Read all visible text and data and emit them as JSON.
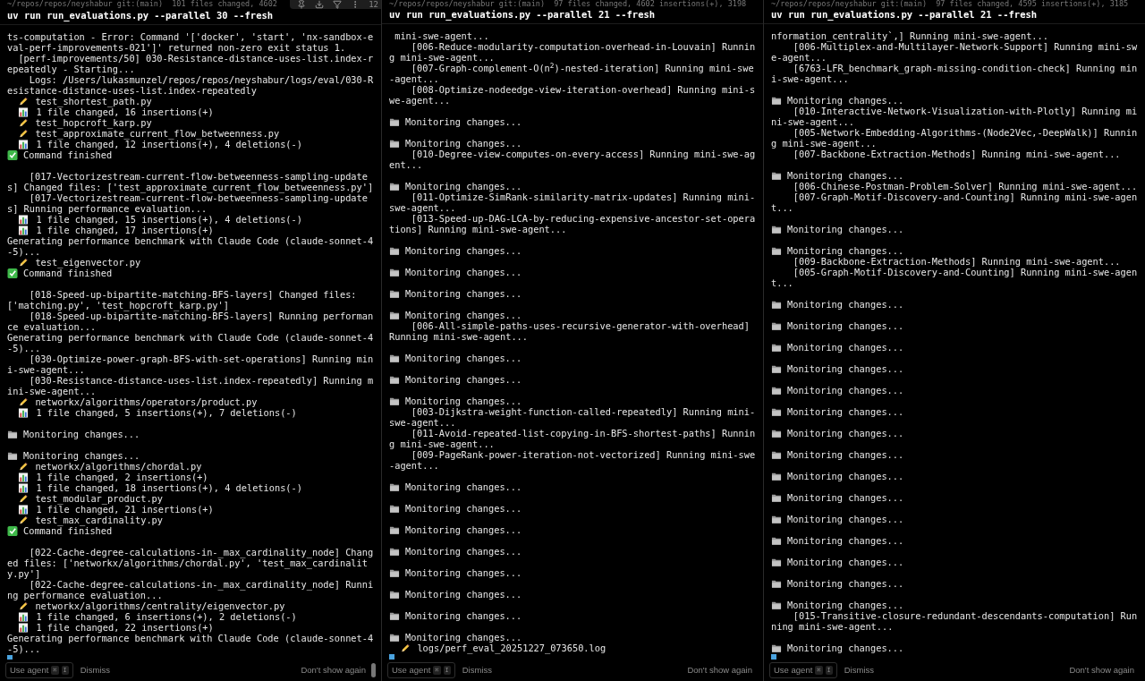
{
  "panes": [
    {
      "status": "~/repos/repos/neyshabur git:(main)  101 files changed, 4602",
      "command": "uv run run_evaluations.py --parallel 30 --fresh",
      "toolbar": {
        "count": "12"
      },
      "scrollbar": true,
      "lines": [
        {
          "kind": "text",
          "text": "ts-computation - Error: Command '['docker', 'start', 'nx-sandbox-eval-perf-improvements-021']' returned non-zero exit status 1."
        },
        {
          "kind": "sub",
          "text": "[perf-improvements/50] 030-Resistance-distance-uses-list.index-repeatedly - Starting..."
        },
        {
          "kind": "task",
          "text": "Logs: /Users/lukasmunzel/repos/repos/neyshabur/logs/eval/030-Resistance-distance-uses-list.index-repeatedly"
        },
        {
          "kind": "edit",
          "text": "test_shortest_path.py"
        },
        {
          "kind": "stats",
          "text": "1 file changed, 16 insertions(+)"
        },
        {
          "kind": "edit",
          "text": "test_hopcroft_karp.py"
        },
        {
          "kind": "edit",
          "text": "test_approximate_current_flow_betweenness.py"
        },
        {
          "kind": "stats",
          "text": "1 file changed, 12 insertions(+), 4 deletions(-)"
        },
        {
          "kind": "done",
          "text": "Command finished"
        },
        {
          "kind": "blank"
        },
        {
          "kind": "task",
          "text": "[017-Vectorizestream-current-flow-betweenness-sampling-updates] Changed files: ['test_approximate_current_flow_betweenness.py']"
        },
        {
          "kind": "task",
          "text": "[017-Vectorizestream-current-flow-betweenness-sampling-updates] Running performance evaluation..."
        },
        {
          "kind": "stats",
          "text": "1 file changed, 15 insertions(+), 4 deletions(-)"
        },
        {
          "kind": "stats",
          "text": "1 file changed, 17 insertions(+)"
        },
        {
          "kind": "text",
          "text": "Generating performance benchmark with Claude Code (claude-sonnet-4-5)..."
        },
        {
          "kind": "edit",
          "text": "test_eigenvector.py"
        },
        {
          "kind": "done",
          "text": "Command finished"
        },
        {
          "kind": "blank"
        },
        {
          "kind": "task",
          "text": "[018-Speed-up-bipartite-matching-BFS-layers] Changed files: ['matching.py', 'test_hopcroft_karp.py']"
        },
        {
          "kind": "task",
          "text": "[018-Speed-up-bipartite-matching-BFS-layers] Running performance evaluation..."
        },
        {
          "kind": "text",
          "text": "Generating performance benchmark with Claude Code (claude-sonnet-4-5)..."
        },
        {
          "kind": "task",
          "text": "[030-Optimize-power-graph-BFS-with-set-operations] Running mini-swe-agent..."
        },
        {
          "kind": "task",
          "text": "[030-Resistance-distance-uses-list.index-repeatedly] Running mini-swe-agent..."
        },
        {
          "kind": "edit",
          "text": "networkx/algorithms/operators/product.py"
        },
        {
          "kind": "stats",
          "text": "1 file changed, 5 insertions(+), 7 deletions(-)"
        },
        {
          "kind": "blank"
        },
        {
          "kind": "monitor",
          "text": "Monitoring changes..."
        },
        {
          "kind": "blank"
        },
        {
          "kind": "monitor",
          "text": "Monitoring changes..."
        },
        {
          "kind": "edit",
          "text": "networkx/algorithms/chordal.py"
        },
        {
          "kind": "stats",
          "text": "1 file changed, 2 insertions(+)"
        },
        {
          "kind": "stats",
          "text": "1 file changed, 18 insertions(+), 4 deletions(-)"
        },
        {
          "kind": "edit",
          "text": "test_modular_product.py"
        },
        {
          "kind": "stats",
          "text": "1 file changed, 21 insertions(+)"
        },
        {
          "kind": "edit",
          "text": "test_max_cardinality.py"
        },
        {
          "kind": "done",
          "text": "Command finished"
        },
        {
          "kind": "blank"
        },
        {
          "kind": "task",
          "text": "[022-Cache-degree-calculations-in-_max_cardinality_node] Changed files: ['networkx/algorithms/chordal.py', 'test_max_cardinality.py']"
        },
        {
          "kind": "task",
          "text": "[022-Cache-degree-calculations-in-_max_cardinality_node] Running performance evaluation..."
        },
        {
          "kind": "edit",
          "text": "networkx/algorithms/centrality/eigenvector.py"
        },
        {
          "kind": "stats",
          "text": "1 file changed, 6 insertions(+), 2 deletions(-)"
        },
        {
          "kind": "stats",
          "text": "1 file changed, 22 insertions(+)"
        },
        {
          "kind": "text",
          "text": "Generating performance benchmark with Claude Code (claude-sonnet-4-5)..."
        }
      ],
      "footer": {
        "use_agent": "Use agent",
        "keys": [
          "⌘",
          "I"
        ],
        "dismiss": "Dismiss",
        "hide": "Don't show again"
      }
    },
    {
      "status": "~/repos/repos/neyshabur git:(main)  97 files changed, 4602 insertions(+), 3198",
      "command": "uv run run_evaluations.py --parallel 21 --fresh",
      "lines": [
        {
          "kind": "text",
          "text": " mini-swe-agent..."
        },
        {
          "kind": "task",
          "text": "[006-Reduce-modularity-computation-overhead-in-Louvain] Running mini-swe-agent..."
        },
        {
          "kind": "task",
          "text": "[007-Graph-complement-O(n$^{2}$)-nested-iteration] Running mini-swe-agent..."
        },
        {
          "kind": "task",
          "text": "[008-Optimize-nodeedge-view-iteration-overhead] Running mini-swe-agent..."
        },
        {
          "kind": "blank"
        },
        {
          "kind": "monitor",
          "text": "Monitoring changes..."
        },
        {
          "kind": "blank"
        },
        {
          "kind": "monitor",
          "text": "Monitoring changes..."
        },
        {
          "kind": "task",
          "text": "[010-Degree-view-computes-on-every-access] Running mini-swe-agent..."
        },
        {
          "kind": "blank"
        },
        {
          "kind": "monitor",
          "text": "Monitoring changes..."
        },
        {
          "kind": "task",
          "text": "[011-Optimize-SimRank-similarity-matrix-updates] Running mini-swe-agent..."
        },
        {
          "kind": "task",
          "text": "[013-Speed-up-DAG-LCA-by-reducing-expensive-ancestor-set-operations] Running mini-swe-agent..."
        },
        {
          "kind": "blank"
        },
        {
          "kind": "monitor",
          "text": "Monitoring changes..."
        },
        {
          "kind": "blank"
        },
        {
          "kind": "monitor",
          "text": "Monitoring changes..."
        },
        {
          "kind": "blank"
        },
        {
          "kind": "monitor",
          "text": "Monitoring changes..."
        },
        {
          "kind": "blank"
        },
        {
          "kind": "monitor",
          "text": "Monitoring changes..."
        },
        {
          "kind": "task",
          "text": "[006-All-simple-paths-uses-recursive-generator-with-overhead] Running mini-swe-agent..."
        },
        {
          "kind": "blank"
        },
        {
          "kind": "monitor",
          "text": "Monitoring changes..."
        },
        {
          "kind": "blank"
        },
        {
          "kind": "monitor",
          "text": "Monitoring changes..."
        },
        {
          "kind": "blank"
        },
        {
          "kind": "monitor",
          "text": "Monitoring changes..."
        },
        {
          "kind": "task",
          "text": "[003-Dijkstra-weight-function-called-repeatedly] Running mini-swe-agent..."
        },
        {
          "kind": "task",
          "text": "[011-Avoid-repeated-list-copying-in-BFS-shortest-paths] Running mini-swe-agent..."
        },
        {
          "kind": "task",
          "text": "[009-PageRank-power-iteration-not-vectorized] Running mini-swe-agent..."
        },
        {
          "kind": "blank"
        },
        {
          "kind": "monitor",
          "text": "Monitoring changes..."
        },
        {
          "kind": "blank"
        },
        {
          "kind": "monitor",
          "text": "Monitoring changes..."
        },
        {
          "kind": "blank"
        },
        {
          "kind": "monitor",
          "text": "Monitoring changes..."
        },
        {
          "kind": "blank"
        },
        {
          "kind": "monitor",
          "text": "Monitoring changes..."
        },
        {
          "kind": "blank"
        },
        {
          "kind": "monitor",
          "text": "Monitoring changes..."
        },
        {
          "kind": "blank"
        },
        {
          "kind": "monitor",
          "text": "Monitoring changes..."
        },
        {
          "kind": "blank"
        },
        {
          "kind": "monitor",
          "text": "Monitoring changes..."
        },
        {
          "kind": "blank"
        },
        {
          "kind": "monitor",
          "text": "Monitoring changes..."
        },
        {
          "kind": "edit",
          "text": "logs/perf_eval_20251227_073650.log"
        }
      ],
      "footer": {
        "use_agent": "Use agent",
        "keys": [
          "⌘",
          "I"
        ],
        "dismiss": "Dismiss",
        "hide": "Don't show again"
      }
    },
    {
      "status": "~/repos/repos/neyshabur git:(main)  97 files changed, 4595 insertions(+), 3185",
      "command": "uv run run_evaluations.py --parallel 21 --fresh",
      "lines": [
        {
          "kind": "text",
          "text": "nformation_centrality`,] Running mini-swe-agent..."
        },
        {
          "kind": "task",
          "text": "[006-Multiplex-and-Multilayer-Network-Support] Running mini-swe-agent..."
        },
        {
          "kind": "task",
          "text": "[6763-LFR_benchmark_graph-missing-condition-check] Running mini-swe-agent..."
        },
        {
          "kind": "blank"
        },
        {
          "kind": "monitor",
          "text": "Monitoring changes..."
        },
        {
          "kind": "task",
          "text": "[010-Interactive-Network-Visualization-with-Plotly] Running mini-swe-agent..."
        },
        {
          "kind": "task",
          "text": "[005-Network-Embedding-Algorithms-(Node2Vec,-DeepWalk)] Running mini-swe-agent..."
        },
        {
          "kind": "task",
          "text": "[007-Backbone-Extraction-Methods] Running mini-swe-agent..."
        },
        {
          "kind": "blank"
        },
        {
          "kind": "monitor",
          "text": "Monitoring changes..."
        },
        {
          "kind": "task",
          "text": "[006-Chinese-Postman-Problem-Solver] Running mini-swe-agent..."
        },
        {
          "kind": "task",
          "text": "[007-Graph-Motif-Discovery-and-Counting] Running mini-swe-agent..."
        },
        {
          "kind": "blank"
        },
        {
          "kind": "monitor",
          "text": "Monitoring changes..."
        },
        {
          "kind": "blank"
        },
        {
          "kind": "monitor",
          "text": "Monitoring changes..."
        },
        {
          "kind": "task",
          "text": "[009-Backbone-Extraction-Methods] Running mini-swe-agent..."
        },
        {
          "kind": "task",
          "text": "[005-Graph-Motif-Discovery-and-Counting] Running mini-swe-agent..."
        },
        {
          "kind": "blank"
        },
        {
          "kind": "monitor",
          "text": "Monitoring changes..."
        },
        {
          "kind": "blank"
        },
        {
          "kind": "monitor",
          "text": "Monitoring changes..."
        },
        {
          "kind": "blank"
        },
        {
          "kind": "monitor",
          "text": "Monitoring changes..."
        },
        {
          "kind": "blank"
        },
        {
          "kind": "monitor",
          "text": "Monitoring changes..."
        },
        {
          "kind": "blank"
        },
        {
          "kind": "monitor",
          "text": "Monitoring changes..."
        },
        {
          "kind": "blank"
        },
        {
          "kind": "monitor",
          "text": "Monitoring changes..."
        },
        {
          "kind": "blank"
        },
        {
          "kind": "monitor",
          "text": "Monitoring changes..."
        },
        {
          "kind": "blank"
        },
        {
          "kind": "monitor",
          "text": "Monitoring changes..."
        },
        {
          "kind": "blank"
        },
        {
          "kind": "monitor",
          "text": "Monitoring changes..."
        },
        {
          "kind": "blank"
        },
        {
          "kind": "monitor",
          "text": "Monitoring changes..."
        },
        {
          "kind": "blank"
        },
        {
          "kind": "monitor",
          "text": "Monitoring changes..."
        },
        {
          "kind": "blank"
        },
        {
          "kind": "monitor",
          "text": "Monitoring changes..."
        },
        {
          "kind": "blank"
        },
        {
          "kind": "monitor",
          "text": "Monitoring changes..."
        },
        {
          "kind": "blank"
        },
        {
          "kind": "monitor",
          "text": "Monitoring changes..."
        },
        {
          "kind": "blank"
        },
        {
          "kind": "monitor",
          "text": "Monitoring changes..."
        },
        {
          "kind": "task",
          "text": "[015-Transitive-closure-redundant-descendants-computation] Running mini-swe-agent..."
        },
        {
          "kind": "blank"
        },
        {
          "kind": "monitor",
          "text": "Monitoring changes..."
        }
      ],
      "footer": {
        "use_agent": "Use agent",
        "keys": [
          "⌘",
          "I"
        ],
        "dismiss": "Dismiss",
        "hide": "Don't show again"
      }
    }
  ]
}
